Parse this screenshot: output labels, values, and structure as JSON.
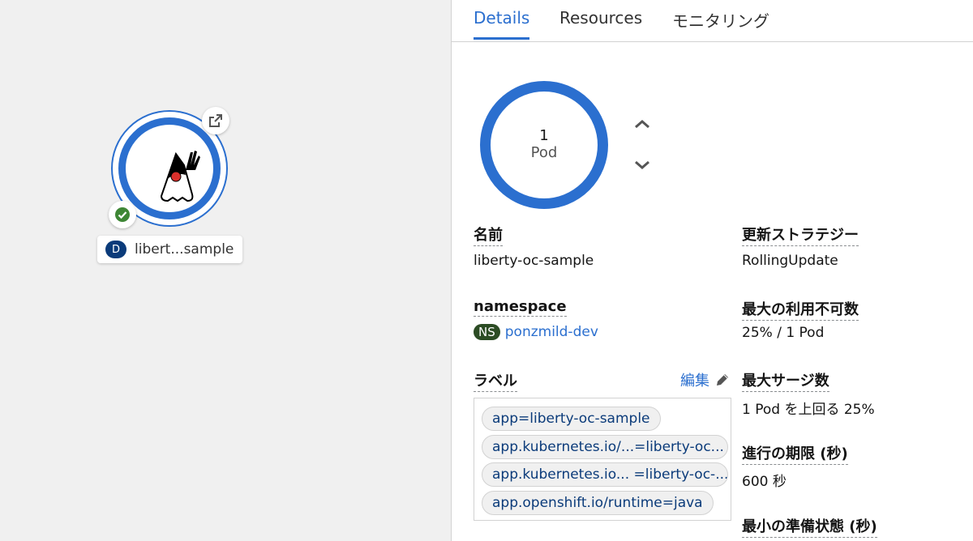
{
  "topology": {
    "node": {
      "kind_badge": "D",
      "name": "libert...sample",
      "status": "running"
    }
  },
  "tabs": [
    {
      "label": "Details",
      "active": true
    },
    {
      "label": "Resources",
      "active": false
    },
    {
      "label": "モニタリング",
      "active": false
    }
  ],
  "pods": {
    "count": "1",
    "unit": "Pod"
  },
  "details": {
    "name_label": "名前",
    "name_value": "liberty-oc-sample",
    "namespace_label": "namespace",
    "namespace_badge": "NS",
    "namespace_value": "ponzmild-dev",
    "labels_label": "ラベル",
    "edit_label": "編集",
    "labels": [
      "app=liberty-oc-sample",
      "app.kubernetes.io/...=liberty-oc...",
      "app.kubernetes.io... =liberty-oc-...",
      "app.openshift.io/runtime=java"
    ],
    "strategy_label": "更新ストラテジー",
    "strategy_value": "RollingUpdate",
    "max_unavailable_label": "最大の利用不可数",
    "max_unavailable_value": "25% / 1 Pod",
    "max_surge_label": "最大サージ数",
    "max_surge_value": "1 Pod を上回る 25%",
    "progress_deadline_label": "進行の期限 (秒)",
    "progress_deadline_value": "600 秒",
    "min_ready_label": "最小の準備状態 (秒)"
  },
  "colors": {
    "accent": "#2b6fcf",
    "status_ok": "#3e8635",
    "ns_badge": "#2c4c24",
    "kind_badge": "#0b3b7a"
  }
}
